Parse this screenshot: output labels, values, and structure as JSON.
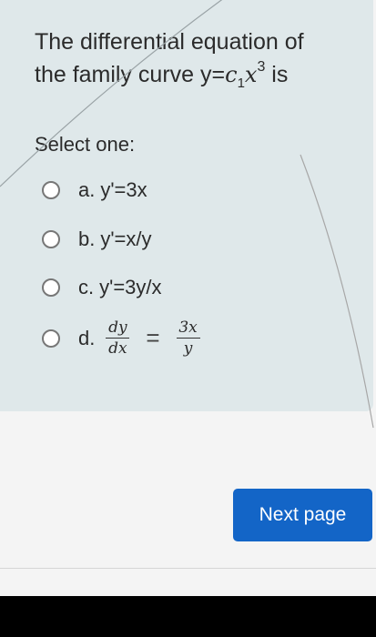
{
  "question": {
    "line1": "The differential equation of",
    "line2_prefix": "the family curve y=",
    "c": "c",
    "c_sub": "1",
    "x": "x",
    "x_sup": "3",
    "line2_suffix": " is"
  },
  "select_label": "Select one:",
  "options": [
    {
      "letter": "a.",
      "text": "y'=3x",
      "selected": false
    },
    {
      "letter": "b.",
      "text": "y'=x/y",
      "selected": false
    },
    {
      "letter": "c.",
      "text": "y'=3y/x",
      "selected": false
    },
    {
      "letter": "d.",
      "lhs_num": "dy",
      "lhs_den": "dx",
      "equals": "=",
      "rhs_num": "3x",
      "rhs_den": "y",
      "selected": false
    }
  ],
  "next_button_label": "Next page",
  "colors": {
    "card_bg": "#dfe8ea",
    "page_bg": "#f4f4f4",
    "button_bg": "#1365c7",
    "text": "#2b2b2b"
  }
}
